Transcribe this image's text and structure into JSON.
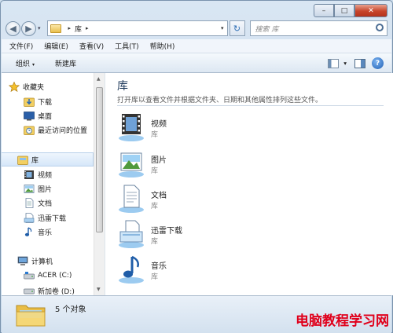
{
  "window": {
    "min": "–",
    "max": "□",
    "close": "✕"
  },
  "nav": {
    "back": "◀",
    "forward": "▶",
    "dropdown": "▾"
  },
  "address": {
    "crumb": "库",
    "sep1": "▸",
    "sep2": "▸",
    "dropdown": "▾",
    "refresh": "↻"
  },
  "search": {
    "placeholder": "搜索 库"
  },
  "menu": [
    "文件(F)",
    "编辑(E)",
    "查看(V)",
    "工具(T)",
    "帮助(H)"
  ],
  "toolbar": {
    "organize": "组织",
    "new_library": "新建库",
    "dd": "▾",
    "help": "?"
  },
  "sidebar": {
    "favorites": "收藏夹",
    "fav_items": [
      "下载",
      "桌面",
      "最近访问的位置"
    ],
    "libraries": "库",
    "lib_items": [
      "视频",
      "图片",
      "文档",
      "迅雷下载",
      "音乐"
    ],
    "computer": "计算机",
    "drives": [
      "ACER (C:)",
      "新加卷 (D:)"
    ],
    "expand": "▸"
  },
  "main": {
    "title": "库",
    "description": "打开库以查看文件并根据文件夹、日期和其他属性排列这些文件。",
    "libraries": [
      {
        "name": "视频",
        "type": "库",
        "icon": "video-library-icon"
      },
      {
        "name": "图片",
        "type": "库",
        "icon": "picture-library-icon"
      },
      {
        "name": "文档",
        "type": "库",
        "icon": "document-library-icon"
      },
      {
        "name": "迅雷下载",
        "type": "库",
        "icon": "download-library-icon"
      },
      {
        "name": "音乐",
        "type": "库",
        "icon": "music-library-icon"
      }
    ]
  },
  "status": {
    "count": "5 个对象"
  },
  "watermark": "电脑教程学习网",
  "colors": {
    "accent": "#1e395b",
    "window": "#c4d7ea",
    "selection": "#d6e7f9",
    "watermark": "#e0001b"
  }
}
